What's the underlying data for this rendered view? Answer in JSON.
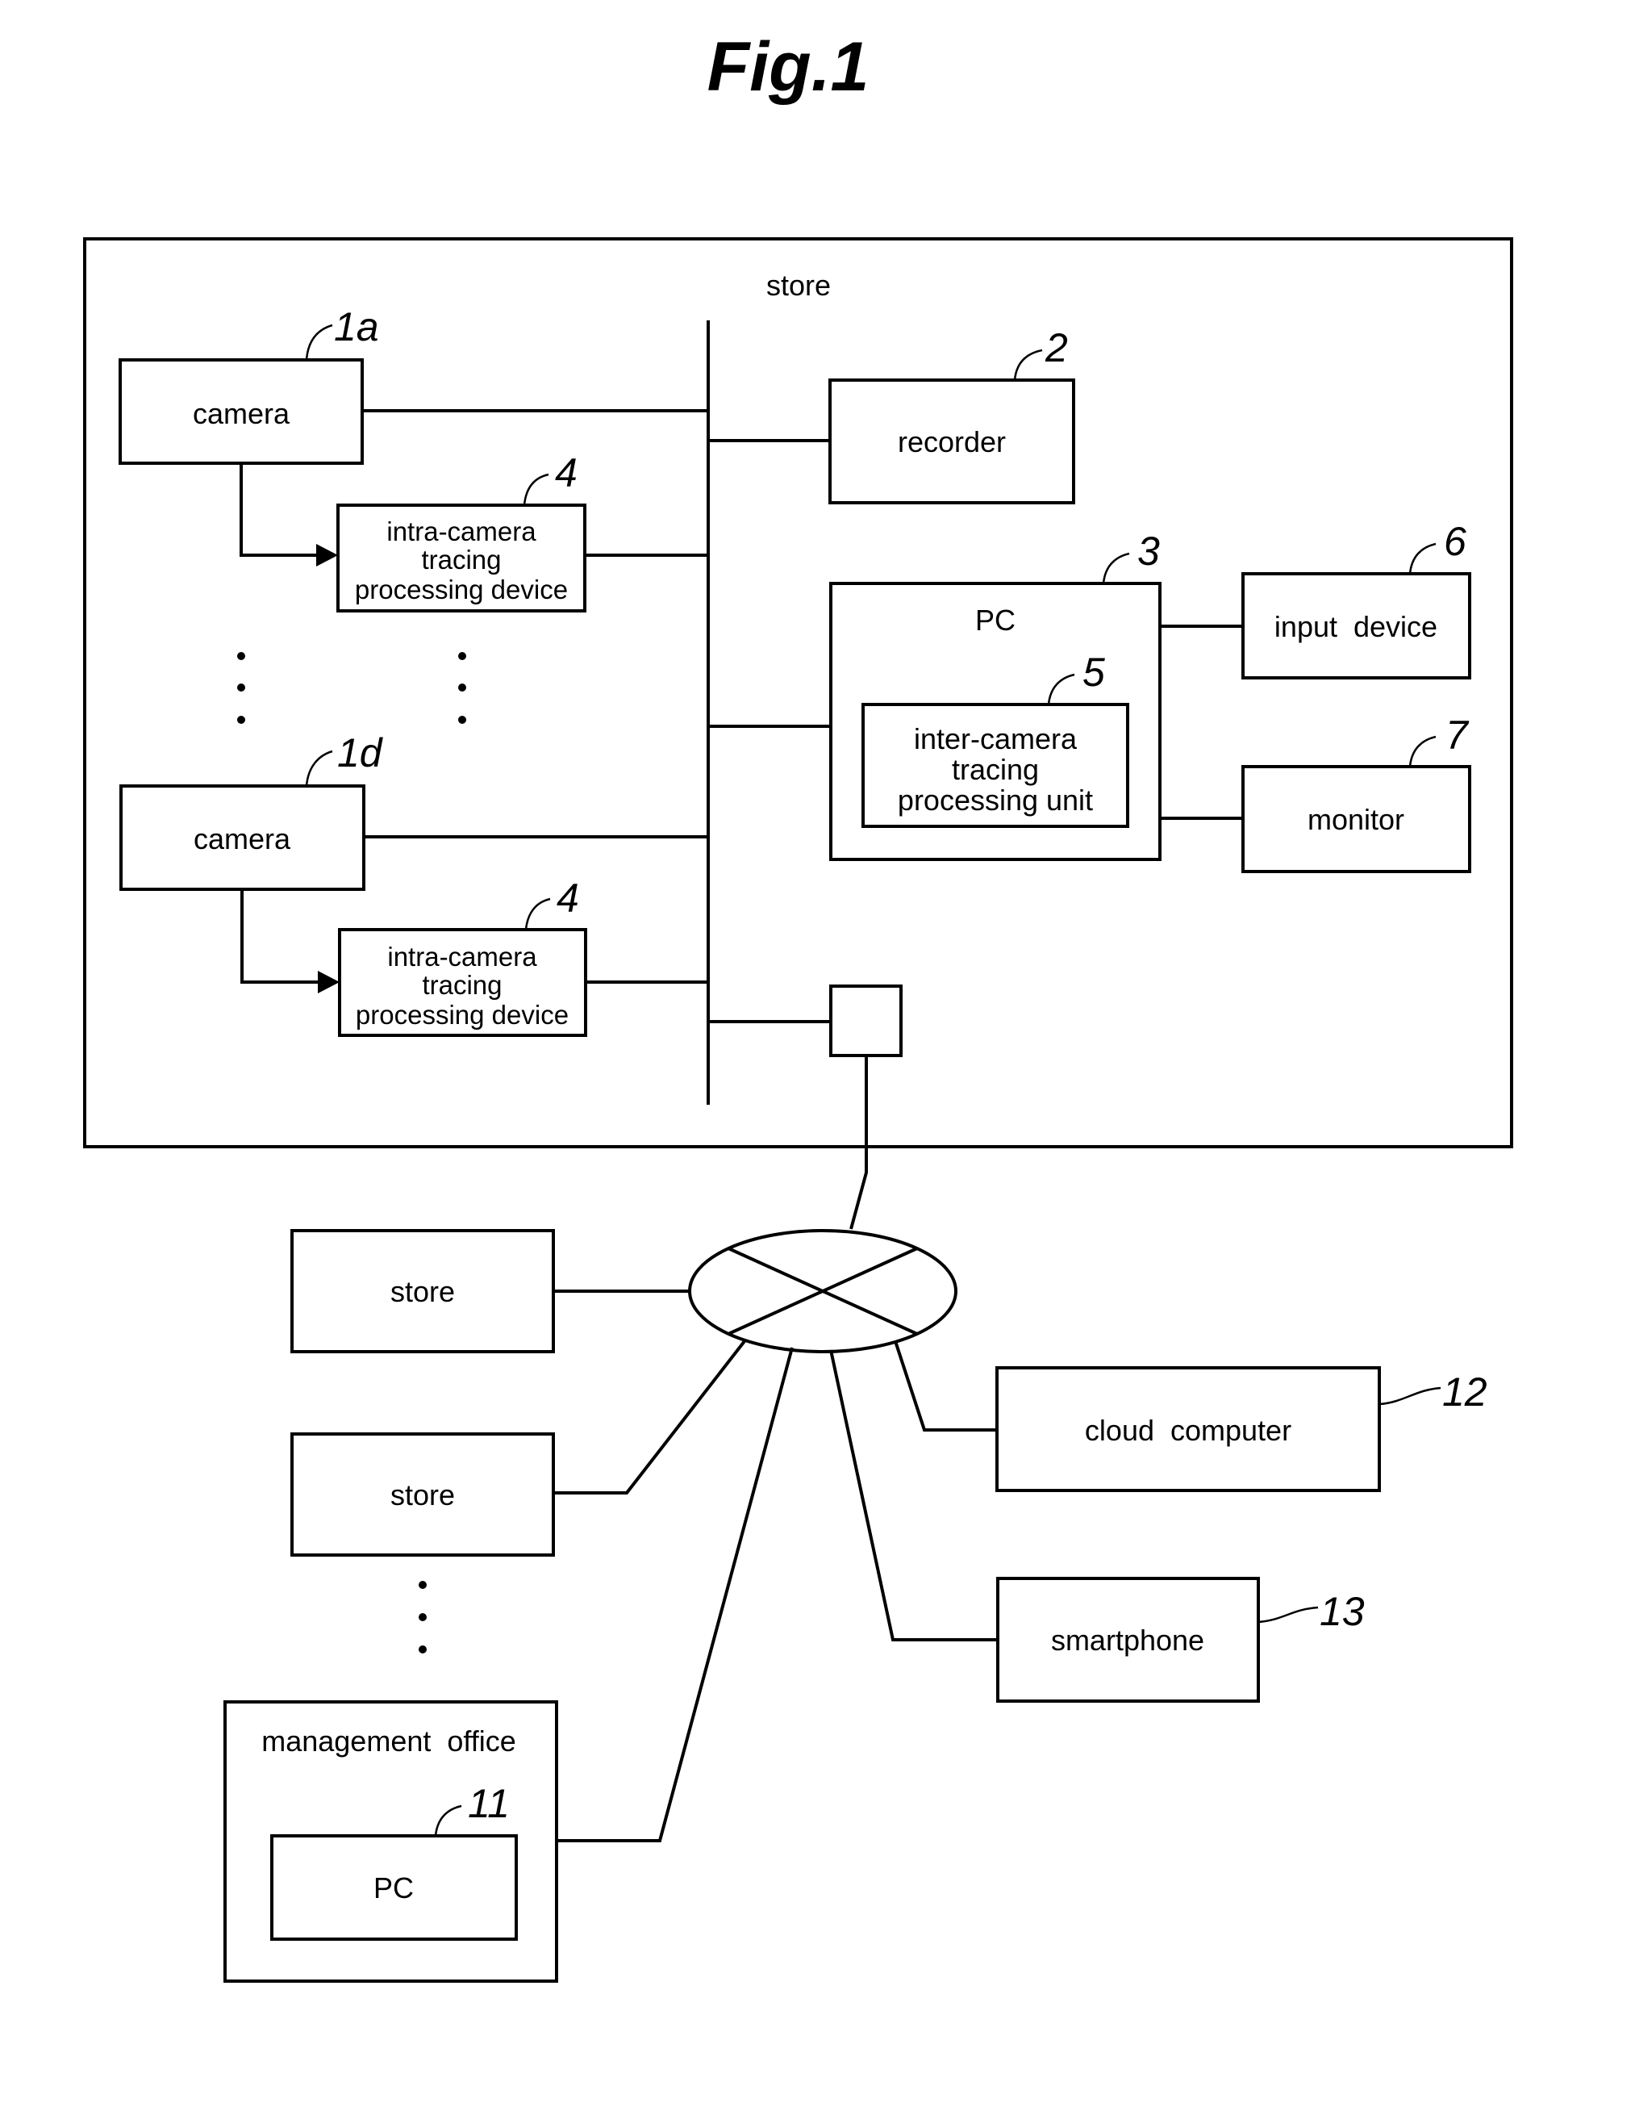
{
  "figure": {
    "title": "Fig.1"
  },
  "store_main": {
    "label": "store",
    "camera_top": {
      "label": "camera",
      "ref": "1a"
    },
    "camera_bottom": {
      "label": "camera",
      "ref": "1d"
    },
    "intra_device_top": {
      "lines": [
        "intra-camera",
        "tracing",
        "processing device"
      ],
      "ref": "4"
    },
    "intra_device_bottom": {
      "lines": [
        "intra-camera",
        "tracing",
        "processing device"
      ],
      "ref": "4"
    },
    "recorder": {
      "label": "recorder",
      "ref": "2"
    },
    "pc": {
      "label": "PC",
      "ref": "3"
    },
    "inter_unit": {
      "lines": [
        "inter-camera",
        "tracing",
        "processing unit"
      ],
      "ref": "5"
    },
    "input_device": {
      "label": "input  device",
      "ref": "6"
    },
    "monitor": {
      "label": "monitor",
      "ref": "7"
    }
  },
  "network": {
    "store_a": {
      "label": "store"
    },
    "store_b": {
      "label": "store"
    },
    "management_office": {
      "label": "management  office",
      "pc": {
        "label": "PC",
        "ref": "11"
      }
    },
    "cloud_computer": {
      "label": "cloud  computer",
      "ref": "12"
    },
    "smartphone": {
      "label": "smartphone",
      "ref": "13"
    }
  }
}
